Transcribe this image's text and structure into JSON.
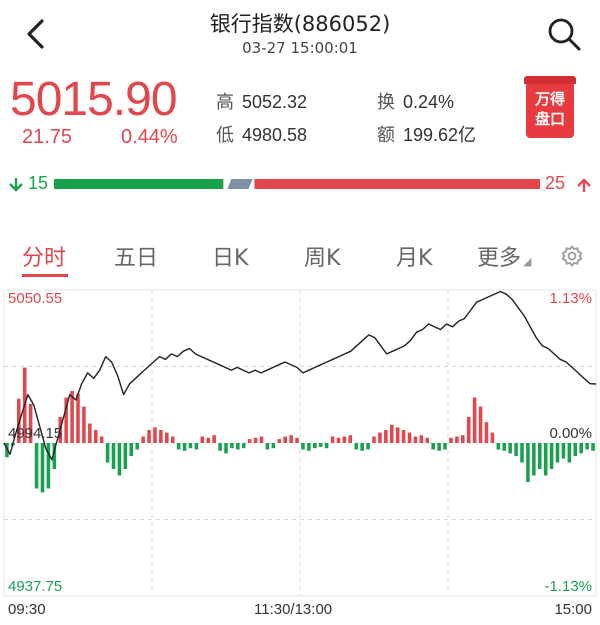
{
  "header": {
    "title": "银行指数(886052)",
    "datetime": "03-27 15:00:01"
  },
  "quote": {
    "price": "5015.90",
    "change": "21.75",
    "change_pct": "0.44%",
    "high_label": "高",
    "high": "5052.32",
    "low_label": "低",
    "low": "4980.58",
    "turnover_label": "换",
    "turnover": "0.24%",
    "amount_label": "额",
    "amount": "199.62亿",
    "color_up": "#e2474d",
    "color_down": "#1aa14f"
  },
  "badge": {
    "line1": "万得",
    "line2": "盘口"
  },
  "breadth": {
    "decliners": "15",
    "advancers": "25",
    "flat_share": 0.06
  },
  "tabs": [
    {
      "label": "分时",
      "active": true
    },
    {
      "label": "五日",
      "active": false
    },
    {
      "label": "日K",
      "active": false
    },
    {
      "label": "周K",
      "active": false
    },
    {
      "label": "月K",
      "active": false
    },
    {
      "label": "更多",
      "active": false
    }
  ],
  "chart_labels": {
    "top_price": "5050.55",
    "top_pct": "1.13%",
    "mid_price": "4994.15",
    "mid_pct": "0.00%",
    "bottom_price": "4937.75",
    "bottom_pct": "-1.13%",
    "time_start": "09:30",
    "time_mid": "11:30/13:00",
    "time_end": "15:00"
  },
  "chart_data": {
    "type": "line",
    "title": "",
    "xlabel": "",
    "ylabel": "",
    "x_ticks": [
      "09:30",
      "11:30/13:00",
      "15:00"
    ],
    "ylim": [
      4937.75,
      5050.55
    ],
    "reference": 4994.15,
    "series": [
      {
        "values": [
          4994.15,
          4990,
          4998,
          5005,
          5012,
          5008,
          5000,
          4992,
          4988,
          4996,
          5004,
          5012,
          5010,
          5016,
          5020,
          5018,
          5021,
          5026,
          5024,
          5019,
          5012,
          5016,
          5018,
          5020,
          5022,
          5024,
          5026,
          5025,
          5027,
          5026,
          5028,
          5029,
          5027,
          5026,
          5025,
          5024,
          5023,
          5022,
          5021,
          5022,
          5021,
          5020,
          5021,
          5020,
          5021,
          5022,
          5023,
          5024,
          5023,
          5022,
          5020,
          5021,
          5022,
          5023,
          5024,
          5025,
          5026,
          5027,
          5028,
          5030,
          5032,
          5034,
          5033,
          5030,
          5027,
          5028,
          5029,
          5030,
          5032,
          5035,
          5036,
          5038,
          5037,
          5036,
          5038,
          5037,
          5039,
          5040,
          5043,
          5046,
          5047,
          5048,
          5049,
          5050,
          5049,
          5047,
          5044,
          5041,
          5037,
          5033,
          5030,
          5029,
          5027,
          5025,
          5024,
          5022,
          5020,
          5018,
          5016,
          5015.9
        ]
      }
    ],
    "volume_pct": [
      -0.11,
      -0.02,
      0.34,
      0.58,
      0.3,
      -0.35,
      -0.38,
      -0.35,
      -0.2,
      0.2,
      0.35,
      0.4,
      0.38,
      0.28,
      0.15,
      0.1,
      0.05,
      -0.15,
      -0.2,
      -0.25,
      -0.2,
      -0.1,
      -0.05,
      0.05,
      0.1,
      0.12,
      0.1,
      0.08,
      0.05,
      -0.05,
      -0.06,
      -0.04,
      -0.05,
      0.05,
      0.04,
      0.06,
      -0.06,
      -0.08,
      -0.04,
      -0.05,
      -0.04,
      0.03,
      0.04,
      0.05,
      -0.05,
      -0.04,
      0.03,
      0.05,
      0.06,
      0.04,
      -0.05,
      -0.06,
      -0.04,
      -0.03,
      -0.04,
      0.05,
      0.04,
      0.05,
      0.06,
      -0.05,
      -0.06,
      -0.05,
      0.05,
      0.08,
      0.1,
      0.14,
      0.12,
      0.1,
      0.08,
      0.05,
      0.06,
      0.04,
      -0.05,
      -0.06,
      -0.05,
      0.04,
      0.05,
      0.06,
      0.2,
      0.35,
      0.28,
      0.16,
      0.08,
      -0.05,
      -0.06,
      -0.08,
      -0.1,
      -0.15,
      -0.3,
      -0.25,
      -0.2,
      -0.25,
      -0.2,
      -0.15,
      -0.12,
      -0.15,
      -0.1,
      -0.08,
      -0.05,
      -0.06
    ]
  }
}
